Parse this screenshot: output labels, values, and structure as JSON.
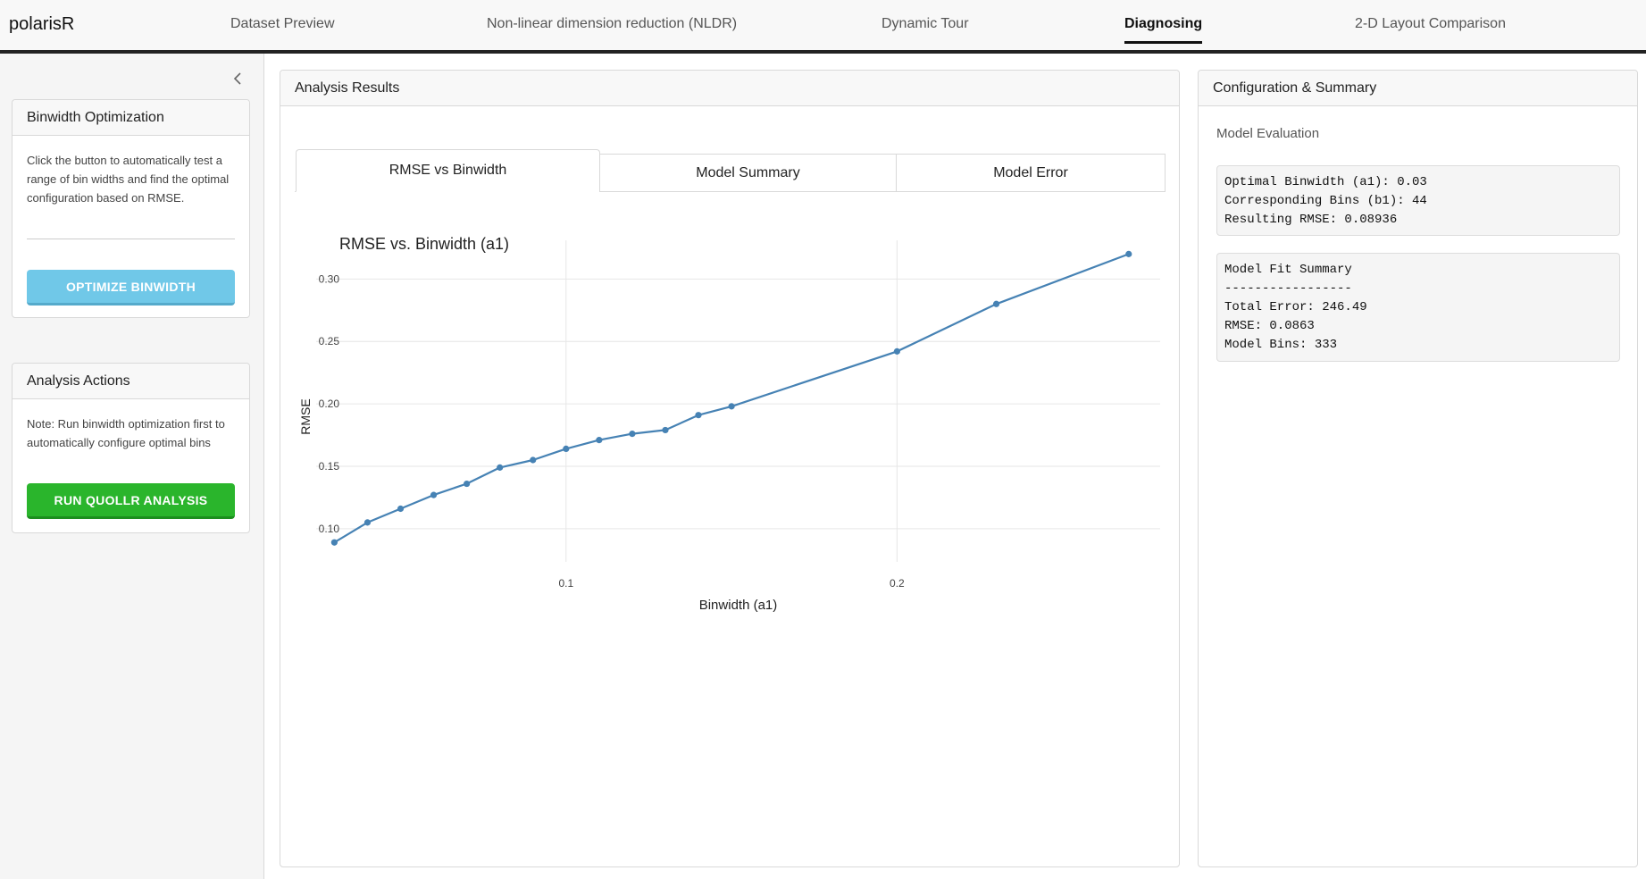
{
  "app": {
    "brand": "polarisR"
  },
  "nav": {
    "items": [
      {
        "label": "Dataset Preview"
      },
      {
        "label": "Non-linear dimension reduction (NLDR)"
      },
      {
        "label": "Dynamic Tour"
      },
      {
        "label": "Diagnosing"
      },
      {
        "label": "2-D Layout Comparison"
      }
    ],
    "active": "Diagnosing"
  },
  "sidebar": {
    "collapse_icon": "chevron-left-icon",
    "binwidth_card": {
      "title": "Binwidth Optimization",
      "description": "Click the button to automatically test a range of bin widths and find the optimal configuration based on RMSE.",
      "button_label": "OPTIMIZE BINWIDTH"
    },
    "actions_card": {
      "title": "Analysis Actions",
      "note": "Note: Run binwidth optimization first to automatically configure optimal bins",
      "button_label": "RUN QUOLLR ANALYSIS"
    }
  },
  "main": {
    "title": "Analysis Results",
    "tabs": [
      {
        "label": "RMSE vs Binwidth"
      },
      {
        "label": "Model Summary"
      },
      {
        "label": "Model Error"
      }
    ],
    "active_tab": "RMSE vs Binwidth"
  },
  "chart_data": {
    "type": "line",
    "title": "RMSE vs. Binwidth (a1)",
    "xlabel": "Binwidth (a1)",
    "ylabel": "RMSE",
    "x_ticks": [
      0.1,
      0.2
    ],
    "x_tick_labels": [
      "0.1",
      "0.2"
    ],
    "y_ticks": [
      0.1,
      0.15,
      0.2,
      0.25,
      0.3
    ],
    "y_tick_labels": [
      "0.10",
      "0.15",
      "0.20",
      "0.25",
      "0.30"
    ],
    "xlim": [
      0.0245,
      0.2795
    ],
    "ylim": [
      0.077,
      0.331
    ],
    "grid": true,
    "color": "#4682b4",
    "x": [
      0.03,
      0.04,
      0.05,
      0.06,
      0.07,
      0.08,
      0.09,
      0.1,
      0.11,
      0.12,
      0.13,
      0.14,
      0.15,
      0.2,
      0.23,
      0.27
    ],
    "y": [
      0.089,
      0.105,
      0.116,
      0.127,
      0.136,
      0.149,
      0.155,
      0.164,
      0.171,
      0.176,
      0.179,
      0.191,
      0.198,
      0.242,
      0.28,
      0.32
    ]
  },
  "summary": {
    "title": "Configuration & Summary",
    "subtitle": "Model Evaluation",
    "optimal_lines": [
      "Optimal Binwidth (a1): 0.03",
      "Corresponding Bins (b1): 44",
      "Resulting RMSE: 0.08936"
    ],
    "fit_lines": [
      "Model Fit Summary",
      "-----------------",
      "Total Error: 246.49",
      "RMSE: 0.0863",
      "Model Bins: 333"
    ]
  }
}
